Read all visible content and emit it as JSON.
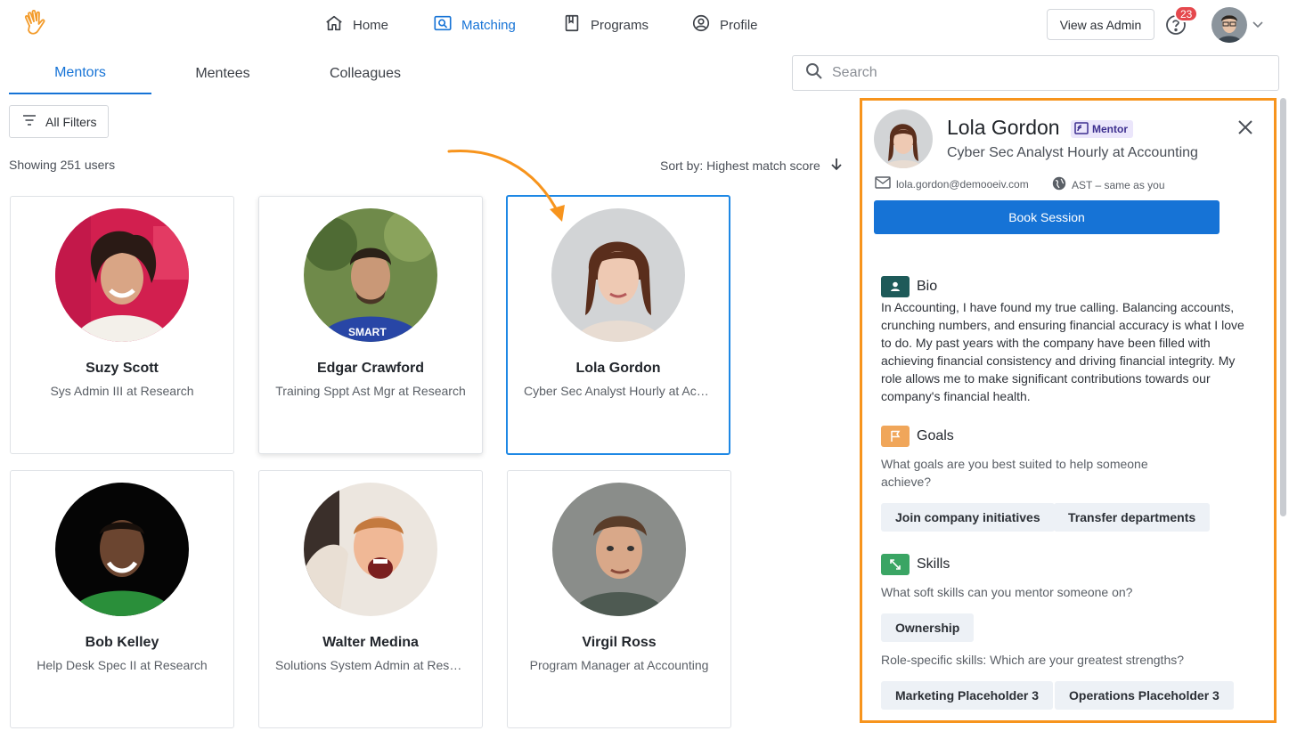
{
  "nav": {
    "home": "Home",
    "matching": "Matching",
    "programs": "Programs",
    "profile": "Profile",
    "view_as_admin": "View as Admin",
    "notifications_count": "23"
  },
  "tabs": [
    "Mentors",
    "Mentees",
    "Colleagues"
  ],
  "search": {
    "placeholder": "Search"
  },
  "filters": {
    "label": "All Filters"
  },
  "results": {
    "showing": "Showing 251 users",
    "sort": "Sort by: Highest match score"
  },
  "cards": [
    {
      "name": "Suzy Scott",
      "role": "Sys Admin III at Research"
    },
    {
      "name": "Edgar Crawford",
      "role": "Training Sppt Ast Mgr at Research"
    },
    {
      "name": "Lola Gordon",
      "role": "Cyber Sec Analyst Hourly at Accounting"
    },
    {
      "name": "Bob Kelley",
      "role": "Help Desk Spec II at Research"
    },
    {
      "name": "Walter Medina",
      "role": "Solutions System Admin at Research"
    },
    {
      "name": "Virgil Ross",
      "role": "Program Manager at Accounting"
    }
  ],
  "panel": {
    "name": "Lola Gordon",
    "badge": "Mentor",
    "title": "Cyber Sec Analyst Hourly at Accounting",
    "email": "lola.gordon@demooeiv.com",
    "timezone": "AST – same as you",
    "book": "Book Session",
    "bio": {
      "heading": "Bio",
      "text": "In Accounting, I have found my true calling. Balancing accounts, crunching numbers, and ensuring financial accuracy is what I love to do. My past years with the company have been filled with achieving financial consistency and driving financial integrity. My role allows me to make significant contributions towards our company's financial health."
    },
    "goals": {
      "heading": "Goals",
      "question": "What goals are you best suited to help someone achieve?",
      "chips": [
        "Join company initiatives",
        "Transfer departments"
      ]
    },
    "skills": {
      "heading": "Skills",
      "soft_question": "What soft skills can you mentor someone on?",
      "soft_chips": [
        "Ownership"
      ],
      "role_question": "Role-specific skills: Which are your greatest strengths?",
      "role_chips": [
        "Marketing Placeholder 3",
        "Operations Placeholder 3"
      ]
    }
  },
  "colors": {
    "accent": "#1673d6",
    "highlight": "#f7941d",
    "selected_border": "#1e88e5",
    "notification": "#e5484d"
  }
}
